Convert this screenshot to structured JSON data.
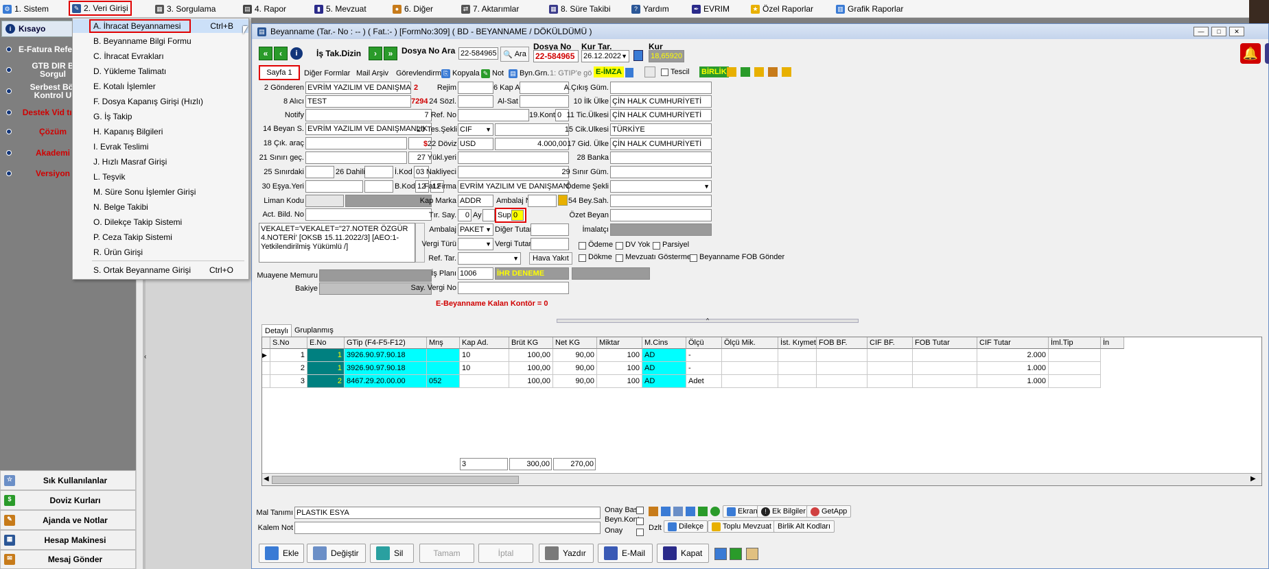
{
  "menubar": {
    "items": [
      {
        "label": "1.  Sistem",
        "icon": "settings-icon",
        "color": "#3a7bd5"
      },
      {
        "label": "2.  Veri Girişi",
        "icon": "edit-icon",
        "color": "#2b5797"
      },
      {
        "label": "3.  Sorgulama",
        "icon": "query-icon",
        "color": "#555555"
      },
      {
        "label": "4.  Rapor",
        "icon": "report-icon",
        "color": "#444444"
      },
      {
        "label": "5.  Mevzuat",
        "icon": "book-icon",
        "color": "#2b2b8a"
      },
      {
        "label": "6.  Diğer",
        "icon": "people-icon",
        "color": "#c77b1a"
      },
      {
        "label": "7.  Aktarımlar",
        "icon": "transfer-icon",
        "color": "#555555"
      },
      {
        "label": "8. Süre Takibi",
        "icon": "calendar-icon",
        "color": "#3a3a8a"
      },
      {
        "label": "Yardım",
        "icon": "help-icon",
        "color": "#2b5797"
      },
      {
        "label": "EVRIM",
        "icon": "pen-icon",
        "color": "#2b2b8a"
      },
      {
        "label": "Özel Raporlar",
        "icon": "star-icon",
        "color": "#e8b000"
      },
      {
        "label": "Grafik Raporlar",
        "icon": "chart-icon",
        "color": "#3a7bd5"
      }
    ]
  },
  "sidebar": {
    "header": "Kısayo",
    "items": [
      {
        "label": "E-Fatura Refer"
      },
      {
        "label": "GTB DIR B Sorgul"
      },
      {
        "label": "Serbest Böl Kontrol U"
      },
      {
        "label": "Destek Vid tıkla"
      },
      {
        "label": "Çözüm"
      },
      {
        "label": "Akademi"
      },
      {
        "label": "Versiyon"
      }
    ],
    "buttons": [
      {
        "label": "Sık Kullanılanlar"
      },
      {
        "label": "Doviz Kurları"
      },
      {
        "label": "Ajanda ve Notlar"
      },
      {
        "label": "Hesap Makinesi"
      },
      {
        "label": "Mesaj Gönder"
      }
    ]
  },
  "dropdown": {
    "items": [
      {
        "label": "A.  İhracat Beyannamesi",
        "shortcut": "Ctrl+B"
      },
      {
        "label": "B.  Beyanname Bilgi Formu",
        "shortcut": ""
      },
      {
        "label": "C.  İhracat Evrakları",
        "shortcut": ""
      },
      {
        "label": "D.  Yükleme Talimatı",
        "shortcut": ""
      },
      {
        "label": "E.  Kotalı İşlemler",
        "shortcut": ""
      },
      {
        "label": "F.  Dosya Kapanış Girişi (Hızlı)",
        "shortcut": ""
      },
      {
        "label": "G.  İş Takip",
        "shortcut": ""
      },
      {
        "label": "H.  Kapanış Bilgileri",
        "shortcut": ""
      },
      {
        "label": "I.   Evrak Teslimi",
        "shortcut": ""
      },
      {
        "label": "J.   Hızlı Masraf Girişi",
        "shortcut": ""
      },
      {
        "label": "L.  Teşvik",
        "shortcut": ""
      },
      {
        "label": "M.   Süre Sonu İşlemler Girişi",
        "shortcut": ""
      },
      {
        "label": "N.  Belge Takibi",
        "shortcut": ""
      },
      {
        "label": "O.  Dilekçe Takip Sistemi",
        "shortcut": ""
      },
      {
        "label": "P.  Ceza Takip Sistemi",
        "shortcut": ""
      },
      {
        "label": "R.  Ürün Girişi",
        "shortcut": ""
      },
      {
        "label": "S.  Ortak Beyanname Girişi",
        "shortcut": "Ctrl+O"
      }
    ]
  },
  "window": {
    "title": "Beyanname (Tar.- No : -- ) ( Fat.:- ) [FormNo:309] ( BD - BEYANNAME / DÖKÜLDÜMÜ )"
  },
  "toolbar": {
    "is_tak_dizin": "İş Tak.Dizin",
    "dosya_no_ara_label": "Dosya No Ara",
    "dosya_no_ara_value": "22-584965",
    "ara": "Ara",
    "dosya_no_label": "Dosya No",
    "dosya_no_value": "22-584965",
    "kur_tar_label": "Kur Tar.",
    "kur_tar_value": "26.12.2022",
    "kur_label": "Kur",
    "kur_value": "18,65920"
  },
  "tabs": {
    "sayfa1": "Sayfa 1",
    "diger_formlar": "Diğer Formlar",
    "mail_arsiv": "Mail Arşiv",
    "gorevlendirme": "Görevlendirme",
    "kopyala": "Kopyala",
    "not": "Not",
    "byn_grn": "Byn.Grn.",
    "gtip_select": "1: GTIP'e gö",
    "e_imza": "E-İMZA",
    "tescil": "Tescil",
    "birlik": "BİRLİK"
  },
  "form": {
    "gonderen_label": "2 Gönderen",
    "gonderen": "EVRİM YAZILIM VE DANIŞMANLIK L",
    "gonderen_no": "2",
    "alici_label": "8 Alıcı",
    "alici": "TEST",
    "alici_no": "7294",
    "notify_label": "Notify",
    "beyan_label": "14 Beyan S.",
    "beyan": "EVRİM YAZILIM VE DANIŞMANLIK",
    "cik_arac_label": "18 Çık. araç",
    "sinir_gec_label": "21 Sınırı geç.",
    "sinirdaki_label": "25 Sınırdaki",
    "dahili_label": "26 Dahili",
    "ikod_label": "İ.Kod",
    "ikod": "03",
    "esya_yeri_label": "30 Eşya.Yeri",
    "bkod_label": "B.Kod",
    "bkod1": "12",
    "bkod2": "12",
    "liman_kodu_label": "Liman Kodu",
    "act_bild_label": "Act. Bild. No",
    "note": "VEKALET='VEKALET=\"27.NOTER ÖZGÜR 4.NOTERİ' [OKSB 15.11.2022/3] [AEO:1-Yetkilendirilmiş Yükümlü /]",
    "muayene_label": "Muayene Memuru",
    "bakiye_label": "Bakiye",
    "rejim_label": "Rejim",
    "kap_a_label": "6 Kap A.",
    "sozl_label": "24 Sözl.",
    "al_sat_label": "Al-Sat",
    "ref_no_label": "7 Ref. No",
    "kont_label": "19.Kont.",
    "kont": "0",
    "tes_sekli_label": "20 Tes.Şekli",
    "tes_sekli": "CIF",
    "doviz_label": "22 Döviz",
    "doviz_symbol": "$",
    "doviz": "USD",
    "doviz_amount": "4.000,00",
    "yuk_yeri_label": "27 Yükl.yeri",
    "nakliyeci_label": "Nakliyeci",
    "fat_firma_label": "Fat.Firma",
    "fat_firma": "EVRİM YAZILIM VE DANIŞMANLIK LT",
    "kap_marka_label": "Kap Marka",
    "kap_marka": "ADDR",
    "ambalaj_no_label": "Ambalaj No",
    "tir_say_label": "Tır. Say.",
    "tir_say": "0",
    "ay_label": "Ay",
    "sup_label": "Sup",
    "sup": "0",
    "ambalaj_label": "Ambalaj",
    "ambalaj": "PAKET",
    "diger_tutar_label": "Diğer Tutar",
    "vergi_turu_label": "Vergi Türü",
    "vergi_tutar_label": "Vergi Tutar",
    "ref_tar_label": "Ref. Tar.",
    "hava_yakit": "Hava Yakıt",
    "is_plani_label": "İş Planı",
    "is_plani": "1006",
    "is_plani_name": "İHR DENEME",
    "say_vergi_label": "Say. Vergi No",
    "kontor_msg": "E-Beyanname Kalan Kontör = 0",
    "cikis_gum_label": "A.Çıkış Güm.",
    "ilk_ulke_label": "10 İlk Ülke",
    "ilk_ulke": "ÇİN HALK CUMHURİYETİ",
    "tic_ulkesi_label": "11 Tic.Ülkesi",
    "tic_ulkesi": "ÇİN HALK CUMHURİYETİ",
    "cik_ulkesi_label": "15 Cik.Ulkesi",
    "cik_ulkesi": "TÜRKİYE",
    "gid_ulke_label": "17 Gid. Ülke",
    "gid_ulke": "ÇİN HALK CUMHURİYETİ",
    "banka_label": "28 Banka",
    "sinir_gum_label": "29 Sınır Güm.",
    "odeme_sekli_label": "Ödeme Şekli",
    "bey_sah_label": "54 Bey.Sah.",
    "ozet_beyan_label": "Özet Beyan",
    "imalatci_label": "İmalatçı",
    "cb_odeme": "Ödeme",
    "cb_dv_yok": "DV Yok",
    "cb_parsiyel": "Parsiyel",
    "cb_dokme": "Dökme",
    "cb_mevzuati": "Mevzuatı Gösterme",
    "cb_fob": "Beyanname FOB Gönder"
  },
  "grid_tabs": {
    "detayli": "Detaylı",
    "gruplanmis": "Gruplanmış"
  },
  "grid": {
    "columns": [
      "S.No",
      "E.No",
      "GTip (F4-F5-F12)",
      "Mnş",
      "Kap Ad.",
      "Brüt KG",
      "Net KG",
      "Miktar",
      "M.Cins",
      "Ölçü",
      "Ölçü Mik.",
      "İst. Kıymet",
      "FOB BF.",
      "CIF BF.",
      "FOB Tutar",
      "CIF Tutar",
      "İml.Tip",
      "İn"
    ],
    "rows": [
      {
        "sno": "1",
        "eno": "1",
        "gtip": "3926.90.97.90.18",
        "mns": "",
        "kap": "10",
        "brut": "100,00",
        "net": "90,00",
        "miktar": "100",
        "mcins": "AD",
        "olcu": "-",
        "cif": "2.000"
      },
      {
        "sno": "2",
        "eno": "1",
        "gtip": "3926.90.97.90.18",
        "mns": "",
        "kap": "10",
        "brut": "100,00",
        "net": "90,00",
        "miktar": "100",
        "mcins": "AD",
        "olcu": "-",
        "cif": "1.000"
      },
      {
        "sno": "3",
        "eno": "2",
        "gtip": "8467.29.20.00.00",
        "mns": "052",
        "kap": "",
        "brut": "100,00",
        "net": "90,00",
        "miktar": "100",
        "mcins": "AD",
        "olcu": "Adet",
        "cif": "1.000"
      }
    ],
    "totals": {
      "count": "3",
      "brut": "300,00",
      "net": "270,00"
    }
  },
  "bottom": {
    "mal_tanimi_label": "Mal Tanımı",
    "mal_tanimi": "PLASTIK ESYA",
    "kalem_not_label": "Kalem Not",
    "onay_bas": "Onay Bas.",
    "beyn_kont": "Beyn.Kont.",
    "onay": "Onay",
    "ekran": "Ekran",
    "ek_bilgiler": "Ek Bilgiler",
    "getapp": "GetApp",
    "dzlt": "Dzlt",
    "dilekce": "Dilekçe",
    "toplu_mevzuat": "Toplu Mevzuat",
    "birlik_alt": "Birlik Alt Kodları"
  },
  "actions": {
    "ekle": "Ekle",
    "degistir": "Değiştir",
    "sil": "Sil",
    "tamam": "Tamam",
    "iptal": "İptal",
    "yazdir": "Yazdır",
    "email": "E-Mail",
    "kapat": "Kapat"
  }
}
